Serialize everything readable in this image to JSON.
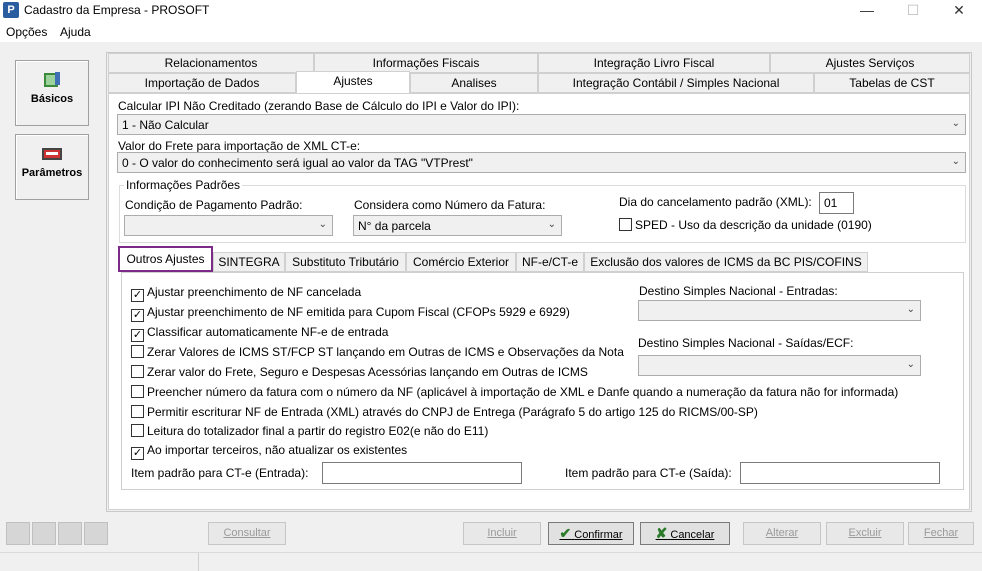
{
  "window": {
    "title": "Cadastro da Empresa - PROSOFT",
    "icon_letter": "P"
  },
  "menu": {
    "items": [
      "Opções",
      "Ajuda"
    ]
  },
  "sidebar": {
    "items": [
      {
        "label": "Básicos",
        "icon": "book-icon"
      },
      {
        "label": "Parâmetros",
        "icon": "keyboard-icon"
      }
    ]
  },
  "tabs_row1": [
    "Relacionamentos",
    "Informações Fiscais",
    "Integração Livro Fiscal",
    "Ajustes Serviços"
  ],
  "tabs_row2": [
    "Importação de Dados",
    "Ajustes",
    "Analises",
    "Integração Contábil / Simples Nacional",
    "Tabelas de CST"
  ],
  "active_tab": "Ajustes",
  "ipi": {
    "label": "Calcular IPI Não Creditado (zerando Base de Cálculo do IPI e Valor do IPI):",
    "value": "1 - Não Calcular"
  },
  "frete": {
    "label": "Valor do Frete para importação de XML CT-e:",
    "value": "0 - O valor do conhecimento será igual ao valor da TAG \"VTPrest\""
  },
  "info_padroes": {
    "title": "Informações Padrões",
    "cond_pag_label": "Condição de Pagamento Padrão:",
    "cond_pag_value": "",
    "num_fatura_label": "Considera como Número da Fatura:",
    "num_fatura_value": "N° da parcela",
    "dia_cancel_label": "Dia do cancelamento padrão (XML):",
    "dia_cancel_value": "01",
    "sped_label": "SPED - Uso da descrição da unidade (0190)",
    "sped_checked": false
  },
  "subtabs": [
    "Outros Ajustes",
    "SINTEGRA",
    "Substituto Tributário",
    "Comércio Exterior",
    "NF-e/CT-e",
    "Exclusão dos valores de ICMS da BC PIS/COFINS"
  ],
  "active_subtab": "Outros Ajustes",
  "checks": [
    {
      "label": "Ajustar preenchimento de NF cancelada",
      "checked": true
    },
    {
      "label": "Ajustar preenchimento de NF emitida para Cupom Fiscal (CFOPs 5929 e 6929)",
      "checked": true
    },
    {
      "label": "Classificar automaticamente NF-e de entrada",
      "checked": true
    },
    {
      "label": "Zerar Valores de ICMS ST/FCP ST lançando em Outras de ICMS e Observações da Nota",
      "checked": false
    },
    {
      "label": "Zerar valor do Frete, Seguro e Despesas Acessórias lançando em Outras de ICMS",
      "checked": false
    },
    {
      "label": "Preencher número da fatura com o número da NF (aplicável à importação de XML e Danfe quando a numeração da fatura não for informada)",
      "checked": false
    },
    {
      "label": "Permitir escriturar NF de Entrada (XML) através do CNPJ de Entrega (Parágrafo 5 do artigo 125 do RICMS/00-SP)",
      "checked": false
    },
    {
      "label": "Leitura do totalizador final a partir do registro E02(e não do E11)",
      "checked": false
    },
    {
      "label": "Ao importar terceiros, não atualizar os existentes",
      "checked": true
    }
  ],
  "destino_entradas": {
    "label": "Destino Simples Nacional - Entradas:",
    "value": ""
  },
  "destino_saidas": {
    "label": "Destino Simples Nacional - Saídas/ECF:",
    "value": ""
  },
  "item_cte_entrada": {
    "label": "Item padrão para CT-e (Entrada):",
    "value": ""
  },
  "item_cte_saida": {
    "label": "Item padrão para CT-e (Saída):",
    "value": ""
  },
  "buttons": {
    "consultar": "Consultar",
    "incluir": "Incluir",
    "confirmar": "Confirmar",
    "cancelar": "Cancelar",
    "alterar": "Alterar",
    "excluir": "Excluir",
    "fechar": "Fechar"
  }
}
